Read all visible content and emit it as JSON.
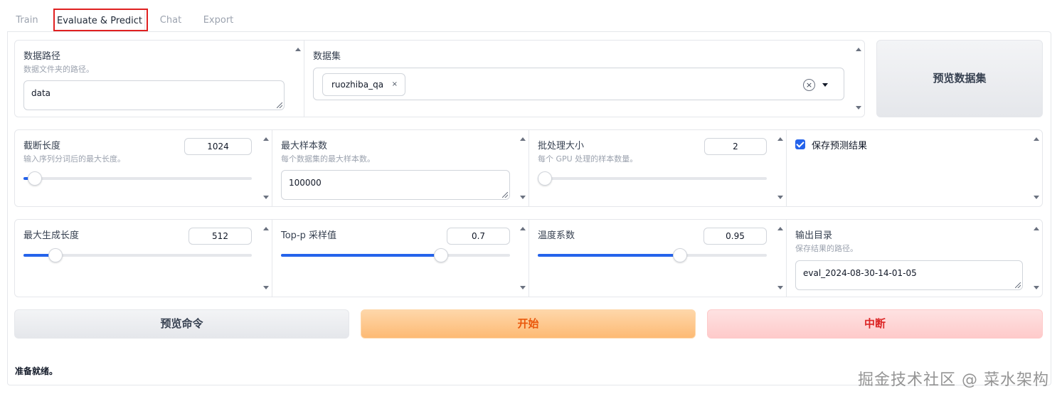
{
  "tabs": [
    {
      "label": "Train"
    },
    {
      "label": "Evaluate & Predict"
    },
    {
      "label": "Chat"
    },
    {
      "label": "Export"
    }
  ],
  "row1": {
    "dataset_dir": {
      "label": "数据路径",
      "info": "数据文件夹的路径。",
      "value": "data"
    },
    "dataset": {
      "label": "数据集",
      "selected": [
        "ruozhiba_qa"
      ],
      "chip_remove": "×",
      "clear": "×"
    },
    "preview_dataset_button": "预览数据集"
  },
  "row2": {
    "cutoff_len": {
      "label": "截断长度",
      "info": "输入序列分词后的最大长度。",
      "value": "1024",
      "fraction": 0.05
    },
    "max_samples": {
      "label": "最大样本数",
      "info": "每个数据集的最大样本数。",
      "value": "100000"
    },
    "batch_size": {
      "label": "批处理大小",
      "info": "每个 GPU 处理的样本数量。",
      "value": "2",
      "fraction": 0.03
    },
    "predict": {
      "label": "保存预测结果",
      "checked": true
    }
  },
  "row3": {
    "max_new_tokens": {
      "label": "最大生成长度",
      "value": "512",
      "fraction": 0.14
    },
    "top_p": {
      "label": "Top-p 采样值",
      "value": "0.7",
      "fraction": 0.7
    },
    "temperature": {
      "label": "温度系数",
      "value": "0.95",
      "fraction": 0.62
    },
    "output_dir": {
      "label": "输出目录",
      "info": "保存结果的路径。",
      "value": "eval_2024-08-30-14-01-05"
    }
  },
  "buttons": {
    "preview_command": "预览命令",
    "start": "开始",
    "stop": "中断"
  },
  "status": "准备就绪。",
  "watermark": "掘金技术社区 @ 菜水架构",
  "colors": {
    "accent": "#2563eb",
    "highlight": "#e02020",
    "start": "#ea580c",
    "stop": "#dc2626"
  }
}
